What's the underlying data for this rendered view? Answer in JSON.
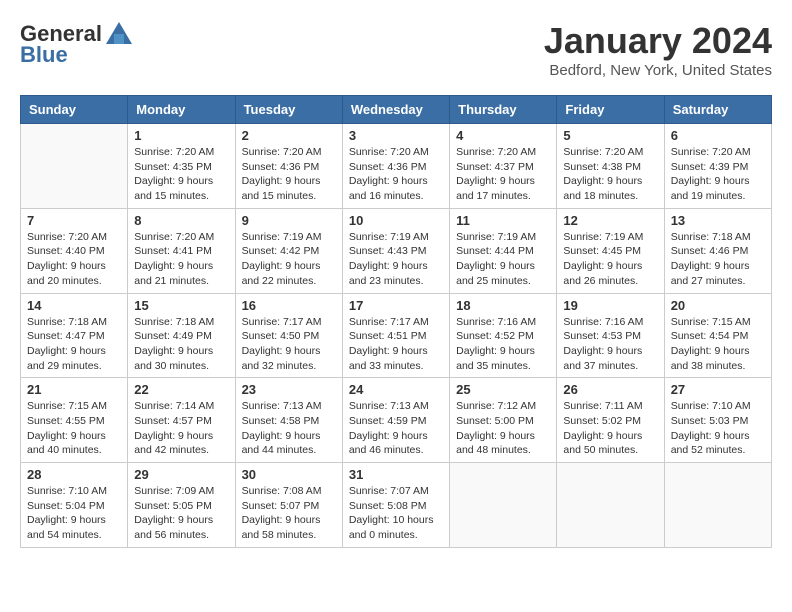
{
  "header": {
    "logo_general": "General",
    "logo_blue": "Blue",
    "title": "January 2024",
    "subtitle": "Bedford, New York, United States"
  },
  "days_of_week": [
    "Sunday",
    "Monday",
    "Tuesday",
    "Wednesday",
    "Thursday",
    "Friday",
    "Saturday"
  ],
  "weeks": [
    [
      {
        "day": "",
        "info": ""
      },
      {
        "day": "1",
        "info": "Sunrise: 7:20 AM\nSunset: 4:35 PM\nDaylight: 9 hours\nand 15 minutes."
      },
      {
        "day": "2",
        "info": "Sunrise: 7:20 AM\nSunset: 4:36 PM\nDaylight: 9 hours\nand 15 minutes."
      },
      {
        "day": "3",
        "info": "Sunrise: 7:20 AM\nSunset: 4:36 PM\nDaylight: 9 hours\nand 16 minutes."
      },
      {
        "day": "4",
        "info": "Sunrise: 7:20 AM\nSunset: 4:37 PM\nDaylight: 9 hours\nand 17 minutes."
      },
      {
        "day": "5",
        "info": "Sunrise: 7:20 AM\nSunset: 4:38 PM\nDaylight: 9 hours\nand 18 minutes."
      },
      {
        "day": "6",
        "info": "Sunrise: 7:20 AM\nSunset: 4:39 PM\nDaylight: 9 hours\nand 19 minutes."
      }
    ],
    [
      {
        "day": "7",
        "info": "Sunrise: 7:20 AM\nSunset: 4:40 PM\nDaylight: 9 hours\nand 20 minutes."
      },
      {
        "day": "8",
        "info": "Sunrise: 7:20 AM\nSunset: 4:41 PM\nDaylight: 9 hours\nand 21 minutes."
      },
      {
        "day": "9",
        "info": "Sunrise: 7:19 AM\nSunset: 4:42 PM\nDaylight: 9 hours\nand 22 minutes."
      },
      {
        "day": "10",
        "info": "Sunrise: 7:19 AM\nSunset: 4:43 PM\nDaylight: 9 hours\nand 23 minutes."
      },
      {
        "day": "11",
        "info": "Sunrise: 7:19 AM\nSunset: 4:44 PM\nDaylight: 9 hours\nand 25 minutes."
      },
      {
        "day": "12",
        "info": "Sunrise: 7:19 AM\nSunset: 4:45 PM\nDaylight: 9 hours\nand 26 minutes."
      },
      {
        "day": "13",
        "info": "Sunrise: 7:18 AM\nSunset: 4:46 PM\nDaylight: 9 hours\nand 27 minutes."
      }
    ],
    [
      {
        "day": "14",
        "info": "Sunrise: 7:18 AM\nSunset: 4:47 PM\nDaylight: 9 hours\nand 29 minutes."
      },
      {
        "day": "15",
        "info": "Sunrise: 7:18 AM\nSunset: 4:49 PM\nDaylight: 9 hours\nand 30 minutes."
      },
      {
        "day": "16",
        "info": "Sunrise: 7:17 AM\nSunset: 4:50 PM\nDaylight: 9 hours\nand 32 minutes."
      },
      {
        "day": "17",
        "info": "Sunrise: 7:17 AM\nSunset: 4:51 PM\nDaylight: 9 hours\nand 33 minutes."
      },
      {
        "day": "18",
        "info": "Sunrise: 7:16 AM\nSunset: 4:52 PM\nDaylight: 9 hours\nand 35 minutes."
      },
      {
        "day": "19",
        "info": "Sunrise: 7:16 AM\nSunset: 4:53 PM\nDaylight: 9 hours\nand 37 minutes."
      },
      {
        "day": "20",
        "info": "Sunrise: 7:15 AM\nSunset: 4:54 PM\nDaylight: 9 hours\nand 38 minutes."
      }
    ],
    [
      {
        "day": "21",
        "info": "Sunrise: 7:15 AM\nSunset: 4:55 PM\nDaylight: 9 hours\nand 40 minutes."
      },
      {
        "day": "22",
        "info": "Sunrise: 7:14 AM\nSunset: 4:57 PM\nDaylight: 9 hours\nand 42 minutes."
      },
      {
        "day": "23",
        "info": "Sunrise: 7:13 AM\nSunset: 4:58 PM\nDaylight: 9 hours\nand 44 minutes."
      },
      {
        "day": "24",
        "info": "Sunrise: 7:13 AM\nSunset: 4:59 PM\nDaylight: 9 hours\nand 46 minutes."
      },
      {
        "day": "25",
        "info": "Sunrise: 7:12 AM\nSunset: 5:00 PM\nDaylight: 9 hours\nand 48 minutes."
      },
      {
        "day": "26",
        "info": "Sunrise: 7:11 AM\nSunset: 5:02 PM\nDaylight: 9 hours\nand 50 minutes."
      },
      {
        "day": "27",
        "info": "Sunrise: 7:10 AM\nSunset: 5:03 PM\nDaylight: 9 hours\nand 52 minutes."
      }
    ],
    [
      {
        "day": "28",
        "info": "Sunrise: 7:10 AM\nSunset: 5:04 PM\nDaylight: 9 hours\nand 54 minutes."
      },
      {
        "day": "29",
        "info": "Sunrise: 7:09 AM\nSunset: 5:05 PM\nDaylight: 9 hours\nand 56 minutes."
      },
      {
        "day": "30",
        "info": "Sunrise: 7:08 AM\nSunset: 5:07 PM\nDaylight: 9 hours\nand 58 minutes."
      },
      {
        "day": "31",
        "info": "Sunrise: 7:07 AM\nSunset: 5:08 PM\nDaylight: 10 hours\nand 0 minutes."
      },
      {
        "day": "",
        "info": ""
      },
      {
        "day": "",
        "info": ""
      },
      {
        "day": "",
        "info": ""
      }
    ]
  ]
}
